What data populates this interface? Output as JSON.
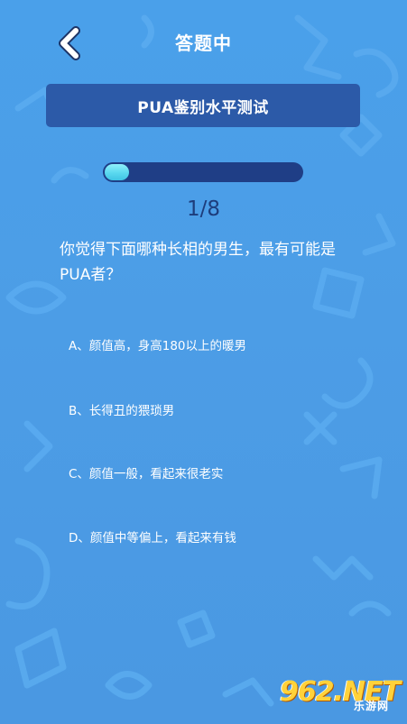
{
  "header": {
    "title": "答题中"
  },
  "quiz": {
    "name": "PUA鉴别水平测试",
    "progress_fraction": 0.125,
    "counter": "1/8",
    "question": "你觉得下面哪种长相的男生，最有可能是PUA者？"
  },
  "options": [
    {
      "label": "A、颜值高，身高180以上的暖男"
    },
    {
      "label": "B、长得丑的猥琐男"
    },
    {
      "label": "C、颜值一般，看起来很老实"
    },
    {
      "label": "D、颜值中等偏上，看起来有钱"
    }
  ],
  "watermark": {
    "main": "962.NET",
    "sub": "乐游网"
  },
  "colors": {
    "background": "#4c9ee6",
    "card": "#2c5aa8",
    "progress_track": "#1f3e86",
    "progress_fill": "#5ad8ef",
    "counter_text": "#1d3d7c"
  },
  "icons": {
    "back": "chevron-left-icon"
  }
}
